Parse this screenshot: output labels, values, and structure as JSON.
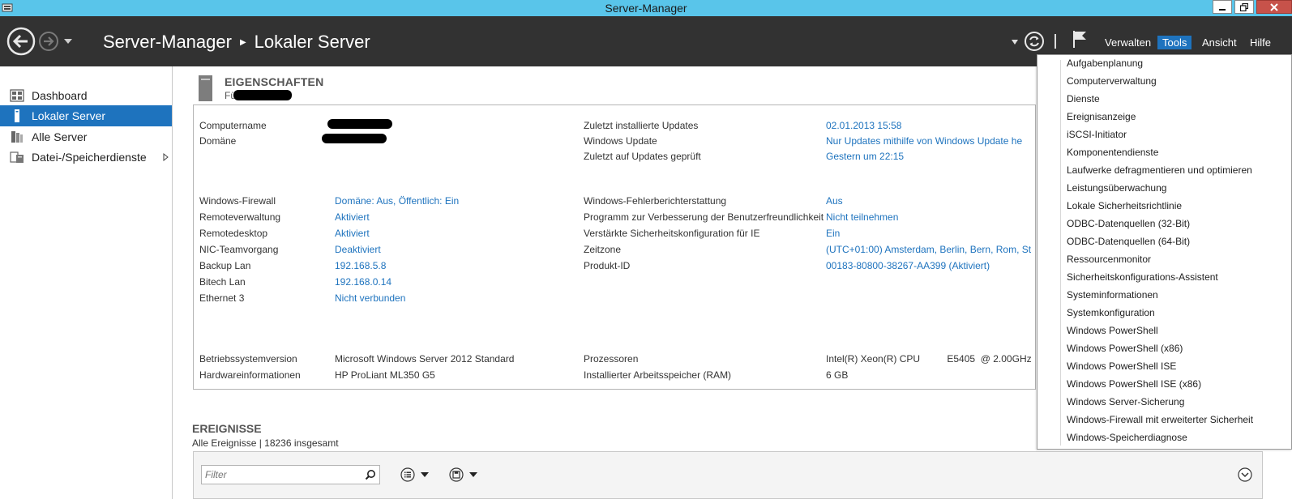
{
  "window": {
    "title": "Server-Manager"
  },
  "header": {
    "breadcrumb": [
      "Server-Manager",
      "Lokaler Server"
    ],
    "menu": {
      "verwalten": "Verwalten",
      "tools": "Tools",
      "ansicht": "Ansicht",
      "hilfe": "Hilfe"
    }
  },
  "sidebar": {
    "items": [
      {
        "label": "Dashboard",
        "icon": "dashboard-icon"
      },
      {
        "label": "Lokaler Server",
        "icon": "local-server-icon",
        "active": true
      },
      {
        "label": "Alle Server",
        "icon": "all-servers-icon"
      },
      {
        "label": "Datei-/Speicherdienste",
        "icon": "file-storage-icon"
      }
    ]
  },
  "properties": {
    "title": "EIGENSCHAFTEN",
    "subtitle": "Für",
    "left_top": [
      {
        "label": "Computername",
        "value": ""
      },
      {
        "label": "Domäne",
        "value": ""
      }
    ],
    "right_top": [
      {
        "label": "Zuletzt installierte Updates",
        "value": "02.01.2013 15:58"
      },
      {
        "label": "Windows Update",
        "value": "Nur Updates mithilfe von Windows Update he"
      },
      {
        "label": "Zuletzt auf Updates geprüft",
        "value": "Gestern um 22:15"
      }
    ],
    "left_mid": [
      {
        "label": "Windows-Firewall",
        "value": "Domäne: Aus, Öffentlich: Ein"
      },
      {
        "label": "Remoteverwaltung",
        "value": "Aktiviert"
      },
      {
        "label": "Remotedesktop",
        "value": "Aktiviert"
      },
      {
        "label": "NIC-Teamvorgang",
        "value": "Deaktiviert"
      },
      {
        "label": "Backup Lan",
        "value": "192.168.5.8"
      },
      {
        "label": "Bitech Lan",
        "value": "192.168.0.14"
      },
      {
        "label": "Ethernet 3",
        "value": "Nicht verbunden"
      }
    ],
    "right_mid": [
      {
        "label": "Windows-Fehlerberichterstattung",
        "value": "Aus"
      },
      {
        "label": "Programm zur Verbesserung der Benutzerfreundlichkeit",
        "value": "Nicht teilnehmen"
      },
      {
        "label": "Verstärkte Sicherheitskonfiguration für IE",
        "value": "Ein"
      },
      {
        "label": "Zeitzone",
        "value": "(UTC+01:00) Amsterdam, Berlin, Bern, Rom, St"
      },
      {
        "label": "Produkt-ID",
        "value": "00183-80800-38267-AA399 (Aktiviert)"
      }
    ],
    "left_bottom": [
      {
        "label": "Betriebssystemversion",
        "value": "Microsoft Windows Server 2012 Standard"
      },
      {
        "label": "Hardwareinformationen",
        "value": "HP ProLiant ML350 G5"
      }
    ],
    "right_bottom": [
      {
        "label": "Prozessoren",
        "value": "Intel(R) Xeon(R) CPU          E5405  @ 2.00GHz"
      },
      {
        "label": "Installierter Arbeitsspeicher (RAM)",
        "value": "6 GB"
      }
    ]
  },
  "tools_menu": {
    "items": [
      "Aufgabenplanung",
      "Computerverwaltung",
      "Dienste",
      "Ereignisanzeige",
      "iSCSI-Initiator",
      "Komponentendienste",
      "Laufwerke defragmentieren und optimieren",
      "Leistungsüberwachung",
      "Lokale Sicherheitsrichtlinie",
      "ODBC-Datenquellen (32-Bit)",
      "ODBC-Datenquellen (64-Bit)",
      "Ressourcenmonitor",
      "Sicherheitskonfigurations-Assistent",
      "Systeminformationen",
      "Systemkonfiguration",
      "Windows PowerShell",
      "Windows PowerShell (x86)",
      "Windows PowerShell ISE",
      "Windows PowerShell ISE (x86)",
      "Windows Server-Sicherung",
      "Windows-Firewall mit erweiterter Sicherheit",
      "Windows-Speicherdiagnose"
    ]
  },
  "events": {
    "title": "EREIGNISSE",
    "subtitle": "Alle Ereignisse | 18236 insgesamt",
    "filter_placeholder": "Filter"
  }
}
